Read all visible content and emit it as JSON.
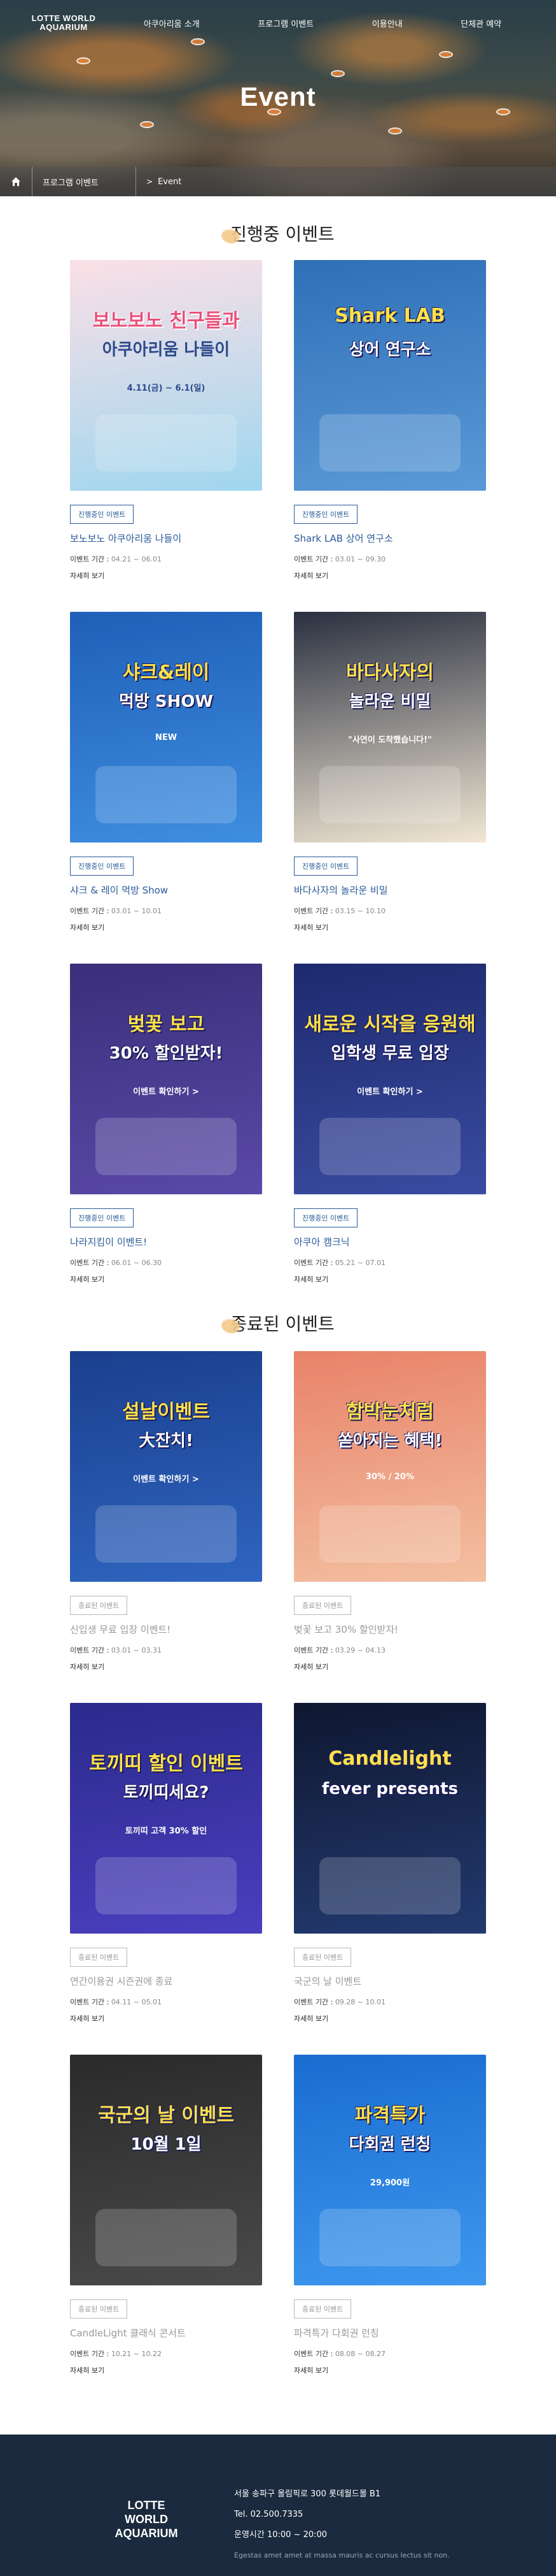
{
  "header": {
    "logo_line1": "LOTTE WORLD",
    "logo_line2": "AQUARIUM",
    "nav": [
      "아쿠아리움 소개",
      "프로그램 이벤트",
      "이용안내",
      "단체관 예약"
    ],
    "hero_title": "Event",
    "breadcrumb": [
      "프로그램 이벤트",
      "Event"
    ],
    "breadcrumb_arrow": ">"
  },
  "sections": {
    "ongoing_title": "진행중 이벤트",
    "ended_title": "종료된 이벤트"
  },
  "labels": {
    "period": "이벤트 기간 :",
    "more": "자세히 보기"
  },
  "ongoing": [
    {
      "badge": "진행중인 이벤트",
      "title": "보노보노 아쿠아리움 나들이",
      "period": "04.21 ~ 06.01",
      "poster_main": "보노보노 친구들과",
      "poster_sub": "아쿠아리움 나들이",
      "poster_date": "4.11(금) ~ 6.1(일)",
      "colors": [
        "#fbe0e6",
        "#9fd6ef"
      ]
    },
    {
      "badge": "진행중인 이벤트",
      "title": "Shark LAB 상어 연구소",
      "period": "03.01 ~ 09.30",
      "poster_main": "Shark LAB",
      "poster_sub": "상어 연구소",
      "poster_date": "",
      "colors": [
        "#2f6fb6",
        "#5a9ad8"
      ]
    },
    {
      "badge": "진행중인 이벤트",
      "title": "샤크 & 레이 먹방 Show",
      "period": "03.01 ~ 10.01",
      "poster_main": "샤크&레이",
      "poster_sub": "먹방 SHOW",
      "poster_date": "NEW",
      "colors": [
        "#1f5fb8",
        "#3e8ee0"
      ]
    },
    {
      "badge": "진행중인 이벤트",
      "title": "바다사자의 놀라운 비밀",
      "period": "03.15 ~ 10.10",
      "poster_main": "바다사자의",
      "poster_sub": "놀라운 비밀",
      "poster_date": "\"사연이 도착했습니다!\"",
      "colors": [
        "#2a3040",
        "#f2e7d4"
      ]
    },
    {
      "badge": "진행중인 이벤트",
      "title": "나라지킴이 이벤트!",
      "period": "06.01 ~ 06.30",
      "poster_main": "벚꽃 보고",
      "poster_sub": "30% 할인받자!",
      "poster_date": "이벤트 확인하기 >",
      "colors": [
        "#3a2f7a",
        "#5a49a8"
      ]
    },
    {
      "badge": "진행중인 이벤트",
      "title": "아쿠아 캠크닉",
      "period": "05.21 ~ 07.01",
      "poster_main": "새로운 시작을 응원해",
      "poster_sub": "입학생 무료 입장",
      "poster_date": "이벤트 확인하기 >",
      "colors": [
        "#1e2a6e",
        "#3a4ba0"
      ]
    }
  ],
  "ended": [
    {
      "badge": "종료된 이벤트",
      "title": "신입생 무료 입장 이벤트!",
      "period": "03.01 ~ 03.31",
      "poster_main": "설날이벤트",
      "poster_sub": "大잔치!",
      "poster_date": "이벤트 확인하기 >",
      "colors": [
        "#1a3f8e",
        "#2f65c0"
      ]
    },
    {
      "badge": "종료된 이벤트",
      "title": "벚꽃 보고 30% 할인받자!",
      "period": "03.29 ~ 04.13",
      "poster_main": "함박눈처럼",
      "poster_sub": "쏟아지는 혜택!",
      "poster_date": "30% / 20%",
      "colors": [
        "#e8826a",
        "#f3c0a0"
      ]
    },
    {
      "badge": "종료된 이벤트",
      "title": "연간이용권 시즌권에 종료",
      "period": "04.11 ~ 05.01",
      "poster_main": "토끼띠 할인 이벤트",
      "poster_sub": "토끼띠세요?",
      "poster_date": "토끼띠 고객 30% 할인",
      "colors": [
        "#2b2a8c",
        "#4a3fbf"
      ]
    },
    {
      "badge": "종료된 이벤트",
      "title": "국군의 날 이벤트",
      "period": "09.28 ~ 10.01",
      "poster_main": "Candlelight",
      "poster_sub": "fever presents",
      "poster_date": "",
      "colors": [
        "#0f1730",
        "#233a70"
      ]
    },
    {
      "badge": "종료된 이벤트",
      "title": "CandleLight 클래식 콘서트",
      "period": "10.21 ~ 10.22",
      "poster_main": "국군의 날 이벤트",
      "poster_sub": "10월 1일",
      "poster_date": "",
      "colors": [
        "#2a2a2a",
        "#4a4a4a"
      ]
    },
    {
      "badge": "종료된 이벤트",
      "title": "파격특가 다회권 런칭",
      "period": "08.08 ~ 08.27",
      "poster_main": "파격특가",
      "poster_sub": "다회권 런칭",
      "poster_date": "29,900원",
      "colors": [
        "#1a6cd0",
        "#3e98ee"
      ]
    }
  ],
  "footer": {
    "logo_line1": "LOTTE WORLD",
    "logo_line2": "AQUARIUM",
    "address": "서울 송파구 올림픽로 300 롯데월드몰 B1",
    "tel": "Tel. 02.500.7335",
    "hours": "운영시간 10:00 ~ 20:00",
    "lorem": "Egestas amet amet at massa mauris ac cursus lectus sit non."
  }
}
